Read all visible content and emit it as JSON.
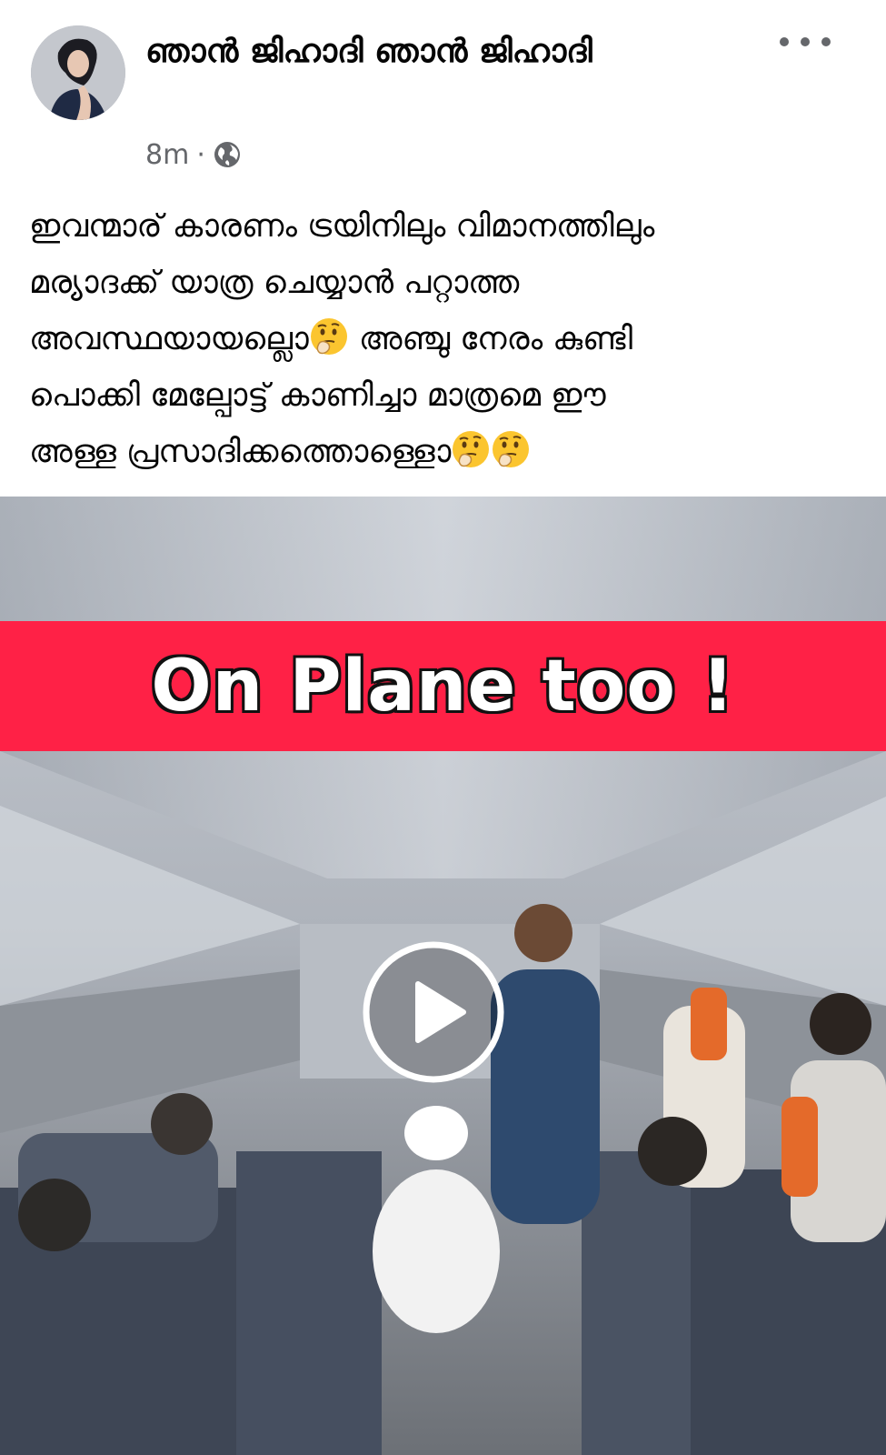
{
  "post": {
    "author_name": "ഞാൻ ജിഹാദി ഞാൻ ജിഹാദി",
    "time_ago": "8m",
    "separator": "·",
    "audience_icon": "globe-icon",
    "more_icon": "more-options-icon",
    "text_lines": [
      "ഇവന്മാര് കാരണം ട്രയിനിലും വിമാനത്തിലും",
      "മര്യാദക്ക് യാത്ര ചെയ്യാൻ പറ്റാത്ത",
      "അവസ്ഥയായല്ലൊ",
      "അഞ്ചു നേരം കുണ്ടി",
      "പൊക്കി മേല്പോട്ട് കാണിച്ചാ മാത്രമെ ഈ",
      "അള്ള പ്രസാദിക്കത്തൊള്ളൊ"
    ],
    "emoji_name": "thinking-face-emoji"
  },
  "video": {
    "banner_text": "On Plane too !",
    "banner_color": "#ff2146",
    "play_icon": "play-icon"
  },
  "colors": {
    "text_primary": "#050505",
    "text_secondary": "#65676b"
  }
}
